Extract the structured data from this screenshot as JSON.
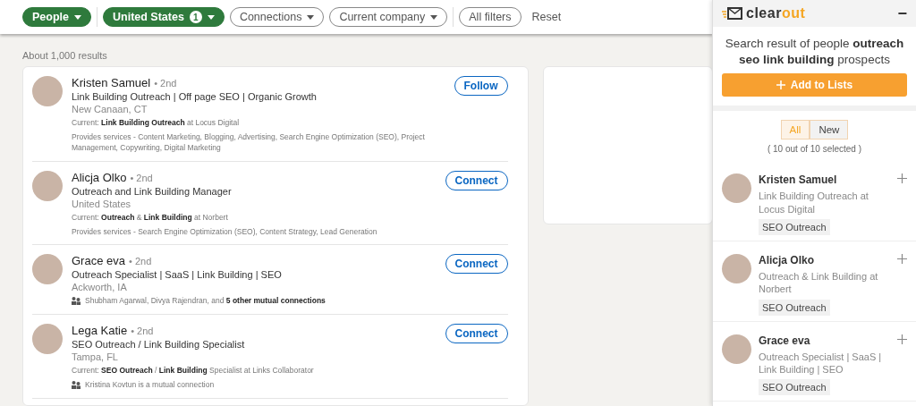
{
  "filters": [
    {
      "label": "People",
      "selected": true,
      "dropdown": true
    },
    {
      "label": "United States",
      "selected": true,
      "dropdown": true,
      "badge": "1"
    },
    {
      "label": "Connections",
      "selected": false,
      "dropdown": true
    },
    {
      "label": "Current company",
      "selected": false,
      "dropdown": true
    },
    {
      "label": "All filters",
      "selected": false,
      "dropdown": false
    }
  ],
  "reset": "Reset",
  "result_count": "About 1,000 results",
  "results": [
    {
      "name": "Kristen Samuel",
      "degree": "• 2nd",
      "headline": "Link Building Outreach | Off page SEO | Organic Growth",
      "location": "New Canaan, CT",
      "action": "Follow",
      "lines": [
        {
          "kind": "current",
          "text": "Current: **Link Building Outreach** at Locus Digital"
        },
        {
          "kind": "services",
          "text": "Provides services - Content Marketing, Blogging, Advertising, Search Engine Optimization (SEO), Project Management, Copywriting, Digital Marketing"
        }
      ]
    },
    {
      "name": "Alicja Olko",
      "degree": "• 2nd",
      "headline": "Outreach and Link Building Manager",
      "location": "United States",
      "action": "Connect",
      "lines": [
        {
          "kind": "current",
          "text": "Current: **Outreach** & **Link Building** at Norbert"
        },
        {
          "kind": "services",
          "text": "Provides services - Search Engine Optimization (SEO), Content Strategy, Lead Generation"
        }
      ]
    },
    {
      "name": "Grace eva",
      "degree": "• 2nd",
      "headline": "Outreach Specialist | SaaS | Link Building | SEO",
      "location": "Ackworth, IA",
      "action": "Connect",
      "lines": [
        {
          "kind": "mutual",
          "text": "Shubham Agarwal, Divya Rajendran, and **5 other mutual connections**"
        }
      ]
    },
    {
      "name": "Lega Katie",
      "degree": "• 2nd",
      "headline": "SEO Outreach / Link Building Specialist",
      "location": "Tampa, FL",
      "action": "Connect",
      "lines": [
        {
          "kind": "current",
          "text": "Current: **SEO Outreach** / **Link Building** Specialist at Links Collaborator"
        },
        {
          "kind": "mutual",
          "text": "Kristina Kovtun is a mutual connection"
        }
      ]
    }
  ],
  "panel": {
    "logo": [
      "clear",
      "out"
    ],
    "minimize": "−",
    "heading": "Search result of people **outreach seo link building** prospects",
    "add_button": "Add to Lists",
    "toggle": [
      {
        "label": "All",
        "selected": true
      },
      {
        "label": "New",
        "selected": false
      }
    ],
    "selection": "( 10 out of 10 selected )",
    "prospects": [
      {
        "name": "Kristen Samuel",
        "title": "Link Building Outreach at Locus Digital",
        "tag": "SEO Outreach"
      },
      {
        "name": "Alicja Olko",
        "title": "Outreach & Link Building at Norbert",
        "tag": "SEO Outreach"
      },
      {
        "name": "Grace eva",
        "title": "Outreach Specialist | SaaS | Link Building | SEO",
        "tag": "SEO Outreach"
      }
    ]
  }
}
